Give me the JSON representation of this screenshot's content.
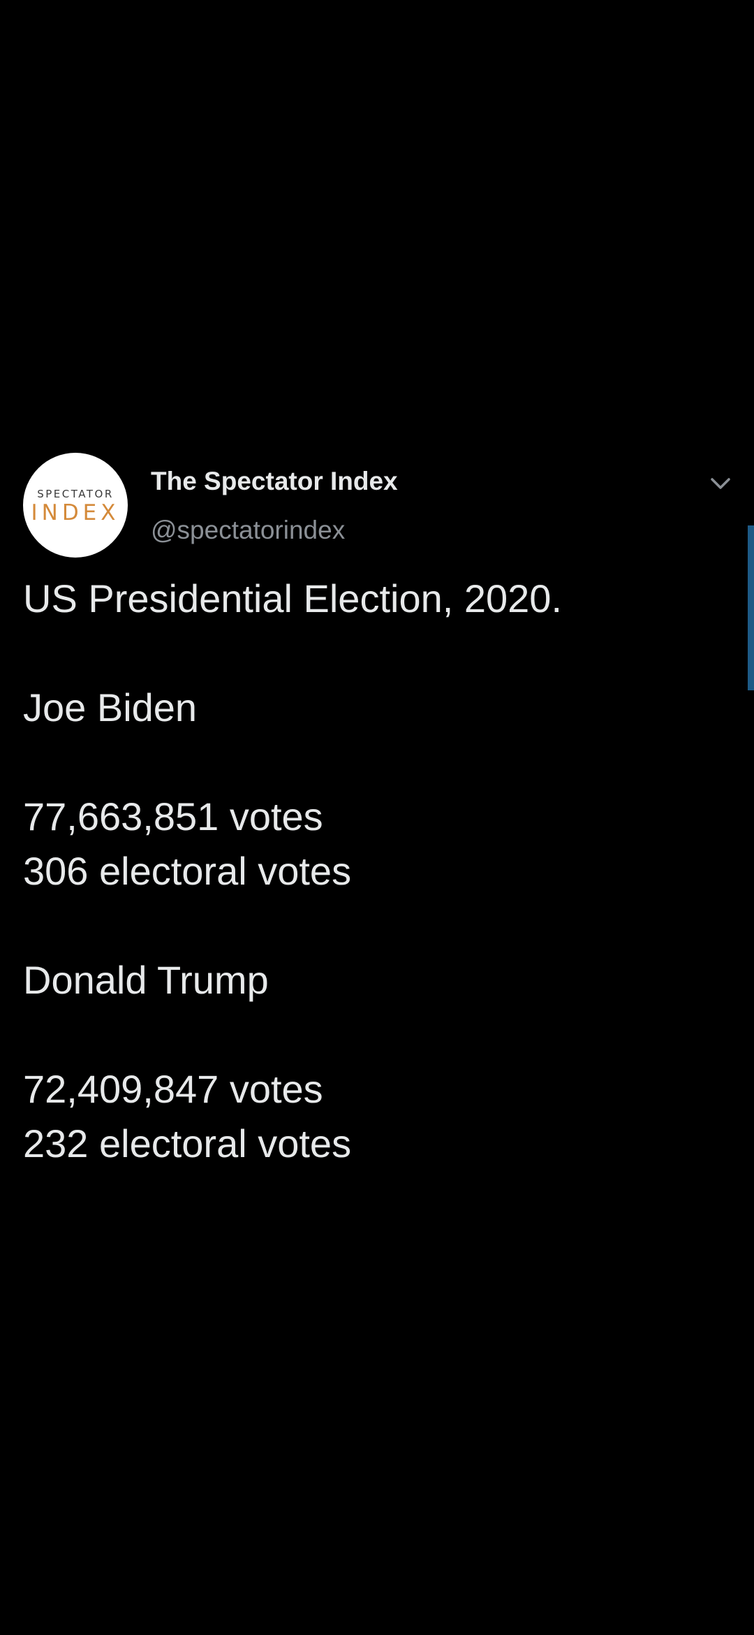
{
  "tweet": {
    "author": {
      "display_name": "The Spectator Index",
      "handle": "@spectatorindex",
      "avatar_logo": {
        "top_text": "SPECTATOR",
        "bottom_text": "INDEX"
      }
    },
    "menu_icon": "chevron-down-icon",
    "body": {
      "title": "US Presidential Election, 2020.",
      "candidates": [
        {
          "name": "Joe Biden",
          "votes": "77,663,851 votes",
          "electoral": "306 electoral votes"
        },
        {
          "name": "Donald Trump",
          "votes": "72,409,847 votes",
          "electoral": "232 electoral votes"
        }
      ]
    }
  },
  "colors": {
    "background": "#000000",
    "text": "#e7e9ea",
    "secondary_text": "#8b9096",
    "logo_accent": "#d48a3a",
    "scroll_indicator": "#1d5a86"
  }
}
